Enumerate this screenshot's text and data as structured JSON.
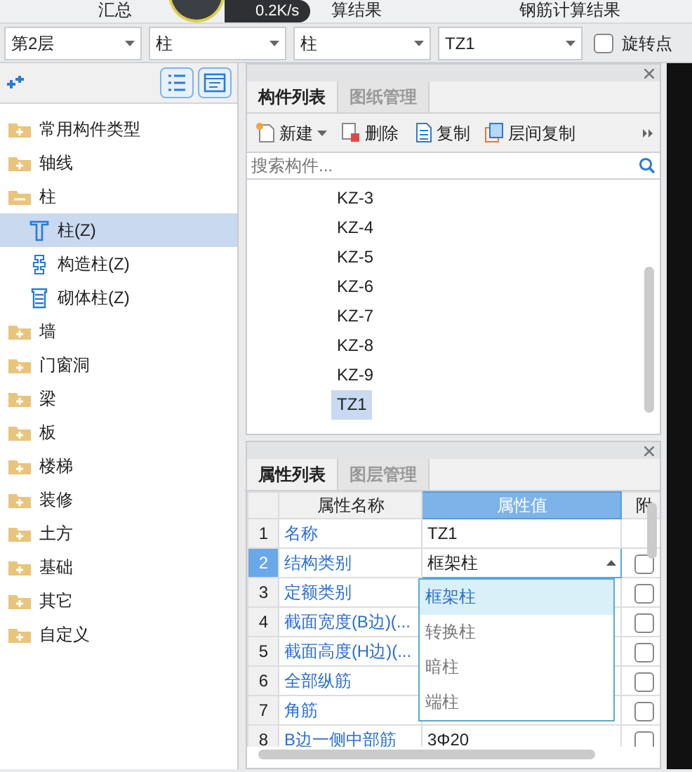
{
  "top_tabs": [
    {
      "label": "汇总"
    },
    {
      "label": "算结果"
    },
    {
      "label": "钢筋计算结果"
    }
  ],
  "network_widget": {
    "speed": "0.2K/s"
  },
  "selectors": [
    {
      "value": "第2层"
    },
    {
      "value": "柱"
    },
    {
      "value": "柱"
    },
    {
      "value": "TZ1"
    }
  ],
  "rotate_point": {
    "label": "旋转点",
    "checked": false
  },
  "tree": {
    "items": [
      {
        "label": "常用构件类型",
        "expanded": false
      },
      {
        "label": "轴线",
        "expanded": false
      },
      {
        "label": "柱",
        "expanded": true,
        "children": [
          {
            "label": "柱(Z)",
            "kind": "column",
            "selected": true
          },
          {
            "label": "构造柱(Z)",
            "kind": "constructional",
            "selected": false
          },
          {
            "label": "砌体柱(Z)",
            "kind": "masonry",
            "selected": false
          }
        ]
      },
      {
        "label": "墙",
        "expanded": false
      },
      {
        "label": "门窗洞",
        "expanded": false
      },
      {
        "label": "梁",
        "expanded": false
      },
      {
        "label": "板",
        "expanded": false
      },
      {
        "label": "楼梯",
        "expanded": false
      },
      {
        "label": "装修",
        "expanded": false
      },
      {
        "label": "土方",
        "expanded": false
      },
      {
        "label": "基础",
        "expanded": false
      },
      {
        "label": "其它",
        "expanded": false
      },
      {
        "label": "自定义",
        "expanded": false
      }
    ]
  },
  "component_panel": {
    "tabs": [
      {
        "label": "构件列表",
        "selected": true
      },
      {
        "label": "图纸管理",
        "selected": false
      }
    ],
    "toolbar": [
      {
        "label": "新建",
        "kind": "new"
      },
      {
        "label": "删除",
        "kind": "delete"
      },
      {
        "label": "复制",
        "kind": "copy"
      },
      {
        "label": "层间复制",
        "kind": "floor-copy"
      }
    ],
    "search": {
      "placeholder": "搜索构件..."
    },
    "items": [
      {
        "label": "KZ-3",
        "selected": false
      },
      {
        "label": "KZ-4",
        "selected": false
      },
      {
        "label": "KZ-5",
        "selected": false
      },
      {
        "label": "KZ-6",
        "selected": false
      },
      {
        "label": "KZ-7",
        "selected": false
      },
      {
        "label": "KZ-8",
        "selected": false
      },
      {
        "label": "KZ-9",
        "selected": false
      },
      {
        "label": "TZ1",
        "selected": true
      }
    ]
  },
  "property_panel": {
    "tabs": [
      {
        "label": "属性列表",
        "selected": true
      },
      {
        "label": "图层管理",
        "selected": false
      }
    ],
    "columns": [
      "属性名称",
      "属性值",
      "附"
    ],
    "rows": [
      {
        "index": "1",
        "name": "名称",
        "value": "TZ1",
        "selected": false,
        "has_checkbox": false
      },
      {
        "index": "2",
        "name": "结构类别",
        "value": "框架柱",
        "selected": true,
        "has_checkbox": true,
        "checked": false
      },
      {
        "index": "3",
        "name": "定额类别",
        "selected": false,
        "has_checkbox": true,
        "checked": false
      },
      {
        "index": "4",
        "name": "截面宽度(B边)(...",
        "selected": false,
        "has_checkbox": true,
        "checked": false
      },
      {
        "index": "5",
        "name": "截面高度(H边)(...",
        "selected": false,
        "has_checkbox": true,
        "checked": false
      },
      {
        "index": "6",
        "name": "全部纵筋",
        "selected": false,
        "has_checkbox": true,
        "checked": false
      },
      {
        "index": "7",
        "name": "角筋",
        "selected": false,
        "has_checkbox": true,
        "checked": false
      },
      {
        "index": "8",
        "name": "B边一侧中部筋",
        "value": "3Φ20",
        "selected": false,
        "has_checkbox": true,
        "checked": false
      }
    ],
    "dropdown": {
      "options": [
        {
          "label": "框架柱",
          "selected": true
        },
        {
          "label": "转换柱",
          "selected": false
        },
        {
          "label": "暗柱",
          "selected": false
        },
        {
          "label": "端柱",
          "selected": false
        }
      ]
    }
  }
}
